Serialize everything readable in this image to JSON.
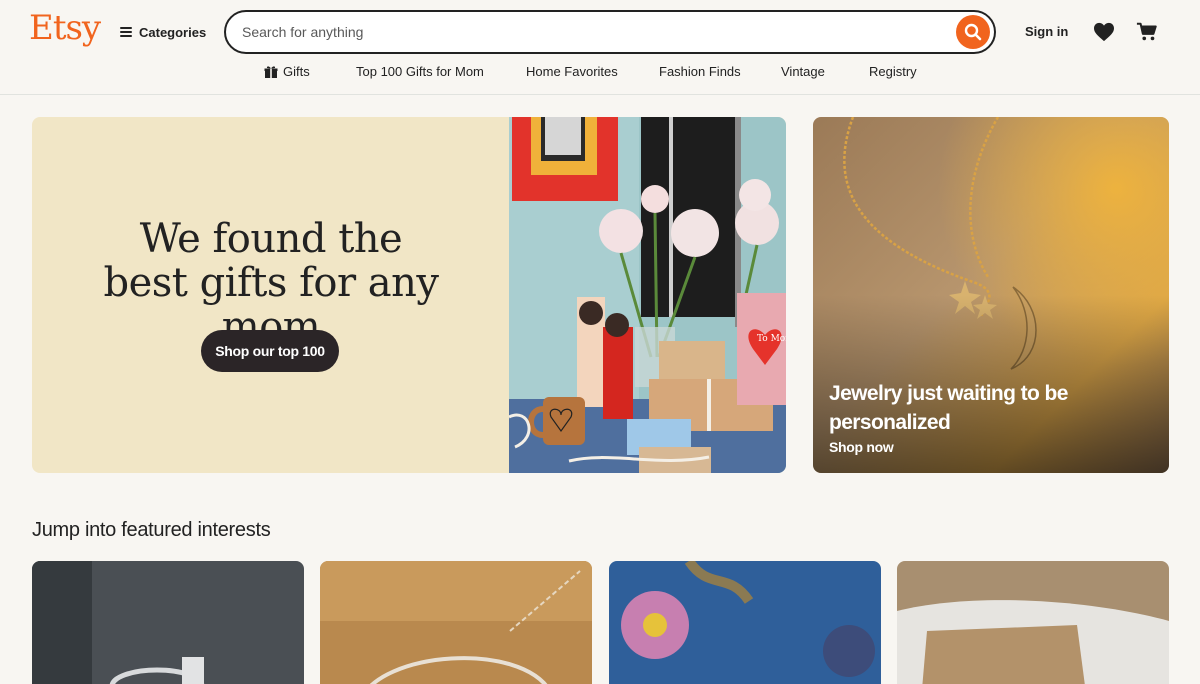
{
  "header": {
    "logo": "Etsy",
    "categories_label": "Categories",
    "search_placeholder": "Search for anything",
    "sign_in": "Sign in"
  },
  "nav": {
    "items": [
      "Gifts",
      "Top 100 Gifts for Mom",
      "Home Favorites",
      "Fashion Finds",
      "Vintage",
      "Registry"
    ]
  },
  "hero": {
    "title": "We found the best gifts for any mom",
    "button": "Shop our top 100",
    "card_text": "To Mom"
  },
  "side_promo": {
    "title": "Jewelry just waiting to be personalized",
    "link": "Shop now"
  },
  "featured": {
    "title": "Jump into featured interests"
  },
  "colors": {
    "brand": "#f1641e",
    "hero_bg": "#f1e6c6",
    "button_dark": "#2b2527"
  }
}
